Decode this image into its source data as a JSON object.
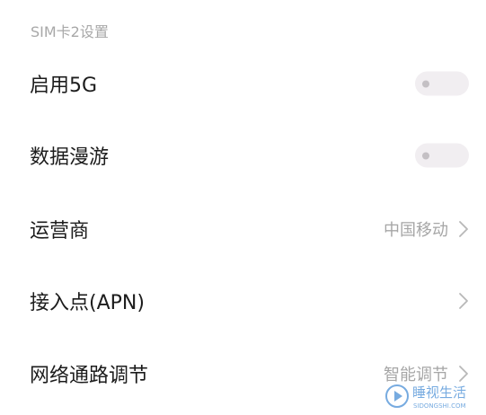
{
  "section": {
    "title": "SIM卡2设置"
  },
  "rows": [
    {
      "label": "启用5G",
      "type": "toggle",
      "state": "off"
    },
    {
      "label": "数据漫游",
      "type": "toggle",
      "state": "off"
    },
    {
      "label": "运营商",
      "type": "link",
      "value": "中国移动",
      "icon": "chevron-right-icon"
    },
    {
      "label": "接入点(APN)",
      "type": "link",
      "value": "",
      "icon": "chevron-right-icon"
    },
    {
      "label": "网络通路调节",
      "type": "link",
      "value": "智能调节",
      "icon": "chevron-right-icon"
    }
  ],
  "watermark": {
    "text": "睡视生活",
    "subtext": "SIDONGSHI.COM",
    "logo": "play-logo-icon"
  },
  "colors": {
    "toggle_track": "#f1eef1",
    "toggle_knob": "#c4c0c4",
    "secondary_text": "#a6a6a6",
    "watermark": "#4a8fd6"
  }
}
